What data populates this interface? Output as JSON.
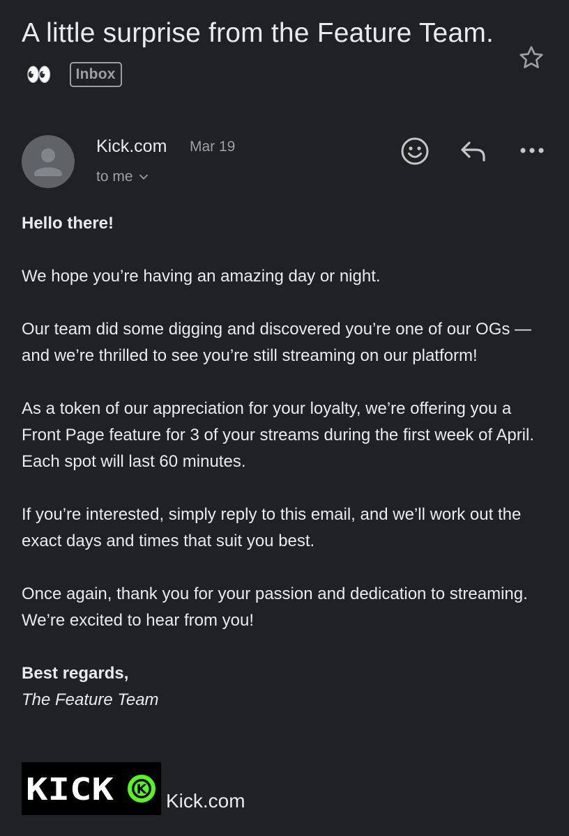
{
  "email": {
    "subject": "A little surprise from the Feature Team.",
    "subject_emoji": "👀",
    "label": "Inbox",
    "sender": {
      "name": "Kick.com",
      "date": "Mar 19",
      "recipient": "to me"
    },
    "body": {
      "greeting": "Hello there!",
      "paragraphs": [
        "We hope you’re having an amazing day or night.",
        "Our team did some digging and discovered you’re one of our OGs — and we’re thrilled to see you’re still streaming on our platform!",
        "As a token of our appreciation for your loyalty, we’re offering you a Front Page feature for 3 of your streams during the first week of April. Each spot will last 60 minutes.",
        "If you’re interested, simply reply to this email, and we’ll work out the exact days and times that suit you best.",
        "Once again, thank you for your passion and dedication to streaming. We’re excited to hear from you!"
      ],
      "signoff": "Best regards,",
      "signature": "The Feature Team"
    },
    "logo": {
      "wordmark": "KICK",
      "badge_letter": "K",
      "link_text": "Kick.com",
      "brand_color": "#53fc18"
    }
  },
  "icons": {
    "star": "star-icon",
    "avatar": "person-icon",
    "emoji_react": "smiley-icon",
    "reply": "reply-icon",
    "more": "more-horizontal-icon",
    "chevron": "chevron-down-icon"
  },
  "colors": {
    "background": "#202124",
    "text": "#e8eaed",
    "secondary_text": "#9aa0a6"
  }
}
